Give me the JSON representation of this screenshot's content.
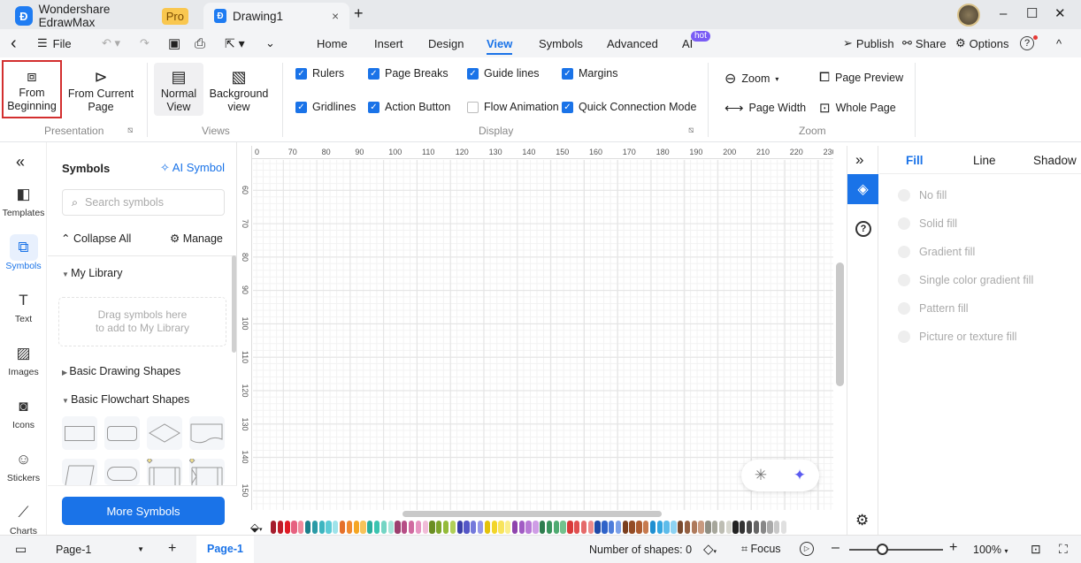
{
  "titlebar": {
    "app_name": "Wondershare EdrawMax",
    "pro_badge": "Pro",
    "doc_tab": "Drawing1",
    "close": "×",
    "new_tab": "+",
    "minimize": "–",
    "maximize": "☐",
    "close_window": "✕"
  },
  "menubar": {
    "back": "‹",
    "file": "File",
    "tabs": [
      "Home",
      "Insert",
      "Design",
      "View",
      "Symbols",
      "Advanced",
      "AI"
    ],
    "active_tab": "View",
    "hot_badge": "hot",
    "publish": "Publish",
    "share": "Share",
    "options": "Options",
    "help": "?",
    "collapse": "^"
  },
  "ribbon": {
    "presentation": {
      "from_beginning": "From\nBeginning",
      "from_current": "From Current\nPage",
      "group": "Presentation"
    },
    "views": {
      "normal": "Normal\nView",
      "background": "Background\nview",
      "group": "Views"
    },
    "display": {
      "group": "Display",
      "options": [
        {
          "label": "Rulers",
          "checked": true
        },
        {
          "label": "Page Breaks",
          "checked": true
        },
        {
          "label": "Guide lines",
          "checked": true
        },
        {
          "label": "Margins",
          "checked": true
        },
        {
          "label": "Gridlines",
          "checked": true
        },
        {
          "label": "Action Button",
          "checked": true
        },
        {
          "label": "Flow Animation",
          "checked": false
        },
        {
          "label": "Quick Connection Mode",
          "checked": true
        }
      ]
    },
    "zoom": {
      "zoom": "Zoom",
      "page_preview": "Page Preview",
      "page_width": "Page Width",
      "whole_page": "Whole Page",
      "group": "Zoom"
    }
  },
  "leftbar": {
    "collapse": "«",
    "items": [
      {
        "label": "Templates",
        "icon": "◧"
      },
      {
        "label": "Symbols",
        "icon": "⧉"
      },
      {
        "label": "Text",
        "icon": "T"
      },
      {
        "label": "Images",
        "icon": "▨"
      },
      {
        "label": "Icons",
        "icon": "◙"
      },
      {
        "label": "Stickers",
        "icon": "☺"
      },
      {
        "label": "Charts",
        "icon": "⟋"
      }
    ],
    "active": "Symbols"
  },
  "symbols": {
    "title": "Symbols",
    "ai_symbol": "AI Symbol",
    "search_placeholder": "Search symbols",
    "collapse_all": "Collapse All",
    "manage": "Manage",
    "my_library": "My Library",
    "drop_hint_1": "Drag symbols here",
    "drop_hint_2": "to add to My Library",
    "sections": [
      "Basic Drawing Shapes",
      "Basic Flowchart Shapes"
    ],
    "more": "More Symbols"
  },
  "ruler": {
    "top": [
      "0",
      "70",
      "80",
      "90",
      "100",
      "110",
      "120",
      "130",
      "140",
      "150",
      "160",
      "170",
      "180",
      "190",
      "200",
      "210",
      "220",
      "230"
    ],
    "left": [
      "60",
      "70",
      "80",
      "90",
      "100",
      "110",
      "120",
      "130",
      "140",
      "150"
    ]
  },
  "palette": [
    "#a51d2d",
    "#c01c28",
    "#e01b24",
    "#e66180",
    "#f08a9c",
    "#1a7f8a",
    "#2a9aa6",
    "#3db5c0",
    "#5ccbd6",
    "#9ee3ea",
    "#e5702a",
    "#f08a30",
    "#f5a623",
    "#f7c35a",
    "#2bae9e",
    "#3cc4b0",
    "#74d5c4",
    "#a6e6da",
    "#9c3f6e",
    "#b64e86",
    "#d06aa0",
    "#e694c1",
    "#f1bcd8",
    "#6b8e23",
    "#7ea52c",
    "#94bb3a",
    "#b1d058",
    "#3b3fa8",
    "#5557c7",
    "#7479db",
    "#9597e8",
    "#e4c20a",
    "#f2d52a",
    "#f8e45c",
    "#faee8a",
    "#8e44ad",
    "#a15cc4",
    "#b87ad6",
    "#cf9de6",
    "#2e7d4f",
    "#3a945e",
    "#4fab72",
    "#73c28e",
    "#d93a3a",
    "#e05050",
    "#e56a6a",
    "#ec8b8b",
    "#1f4aa8",
    "#2f63c9",
    "#4d7ddb",
    "#7aa0e8",
    "#7b3f1e",
    "#944c25",
    "#ad5c30",
    "#c77a4e",
    "#1f8fd1",
    "#35a6e0",
    "#5ebcea",
    "#8dd2f2",
    "#7a4a2e",
    "#946042",
    "#ae7a5c",
    "#c89a80",
    "#8f8f84",
    "#a6a69b",
    "#bdbdb3",
    "#d6d6ce",
    "#222222",
    "#333333",
    "#4a4a4a",
    "#666666",
    "#888888",
    "#aaaaaa",
    "#c8c8c8",
    "#e0e0e0"
  ],
  "statusbar": {
    "page_selector": "Page-1",
    "add_page": "+",
    "page_tab": "Page-1",
    "shapes": "Number of shapes: 0",
    "focus": "Focus",
    "zoom_out": "–",
    "zoom_in": "+",
    "zoom_level": "100%",
    "zoom_fraction": 0.35
  },
  "rightpanel": {
    "expand": "»",
    "tabs": [
      "Fill",
      "Line",
      "Shadow"
    ],
    "active_tab": "Fill",
    "fill_options": [
      "No fill",
      "Solid fill",
      "Gradient fill",
      "Single color gradient fill",
      "Pattern fill",
      "Picture or texture fill"
    ]
  },
  "colors": {
    "accent": "#1a73e8",
    "highlight_border": "#d32f2f"
  }
}
